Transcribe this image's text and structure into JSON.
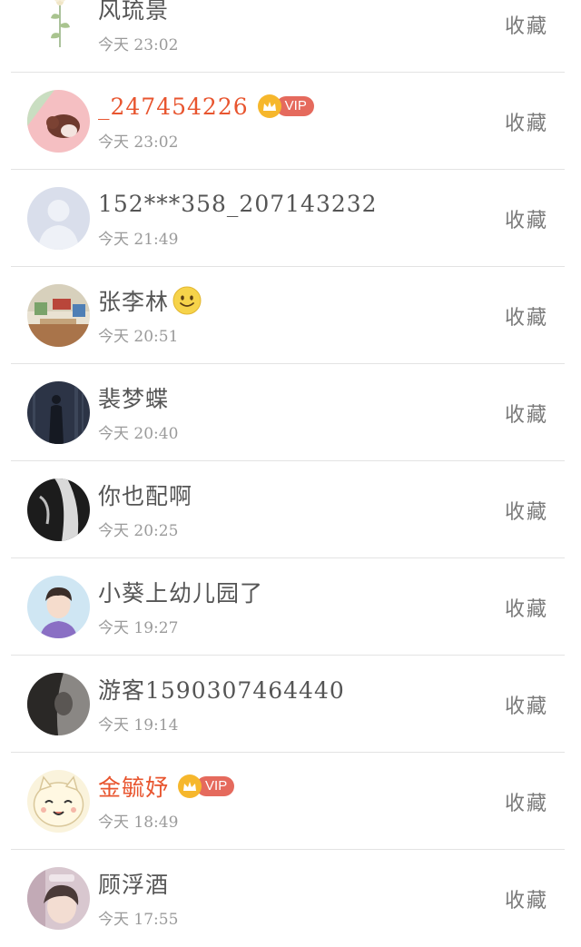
{
  "list": {
    "items": [
      {
        "name": "风琉景",
        "time": "今天 23:02",
        "action": "收藏",
        "vip": false,
        "vip_label": "",
        "avatar": "flower-sketch"
      },
      {
        "name": "_247454226",
        "time": "今天 23:02",
        "action": "收藏",
        "vip": true,
        "vip_label": "VIP",
        "avatar": "pink-girl"
      },
      {
        "name": "152***358_207143232",
        "time": "今天 21:49",
        "action": "收藏",
        "vip": false,
        "vip_label": "",
        "avatar": "default-person"
      },
      {
        "name": "张李林",
        "time": "今天 20:51",
        "action": "收藏",
        "vip": false,
        "vip_label": "",
        "avatar": "classroom",
        "emoji": "smile"
      },
      {
        "name": "裴梦蝶",
        "time": "今天 20:40",
        "action": "收藏",
        "vip": false,
        "vip_label": "",
        "avatar": "dark-forest"
      },
      {
        "name": "你也配啊",
        "time": "今天 20:25",
        "action": "收藏",
        "vip": false,
        "vip_label": "",
        "avatar": "dark-figure"
      },
      {
        "name": "小葵上幼儿园了",
        "time": "今天 19:27",
        "action": "收藏",
        "vip": false,
        "vip_label": "",
        "avatar": "boy-portrait"
      },
      {
        "name": "游客1590307464440",
        "time": "今天 19:14",
        "action": "收藏",
        "vip": false,
        "vip_label": "",
        "avatar": "silhouette"
      },
      {
        "name": "金毓妤",
        "time": "今天 18:49",
        "action": "收藏",
        "vip": true,
        "vip_label": "VIP",
        "avatar": "cartoon-cat"
      },
      {
        "name": "顾浮酒",
        "time": "今天 17:55",
        "action": "收藏",
        "vip": false,
        "vip_label": "",
        "avatar": "girl-photo"
      }
    ]
  },
  "colors": {
    "vip_name": "#e8552f",
    "vip_badge": "#e56a5d",
    "crown": "#f6b72c"
  }
}
